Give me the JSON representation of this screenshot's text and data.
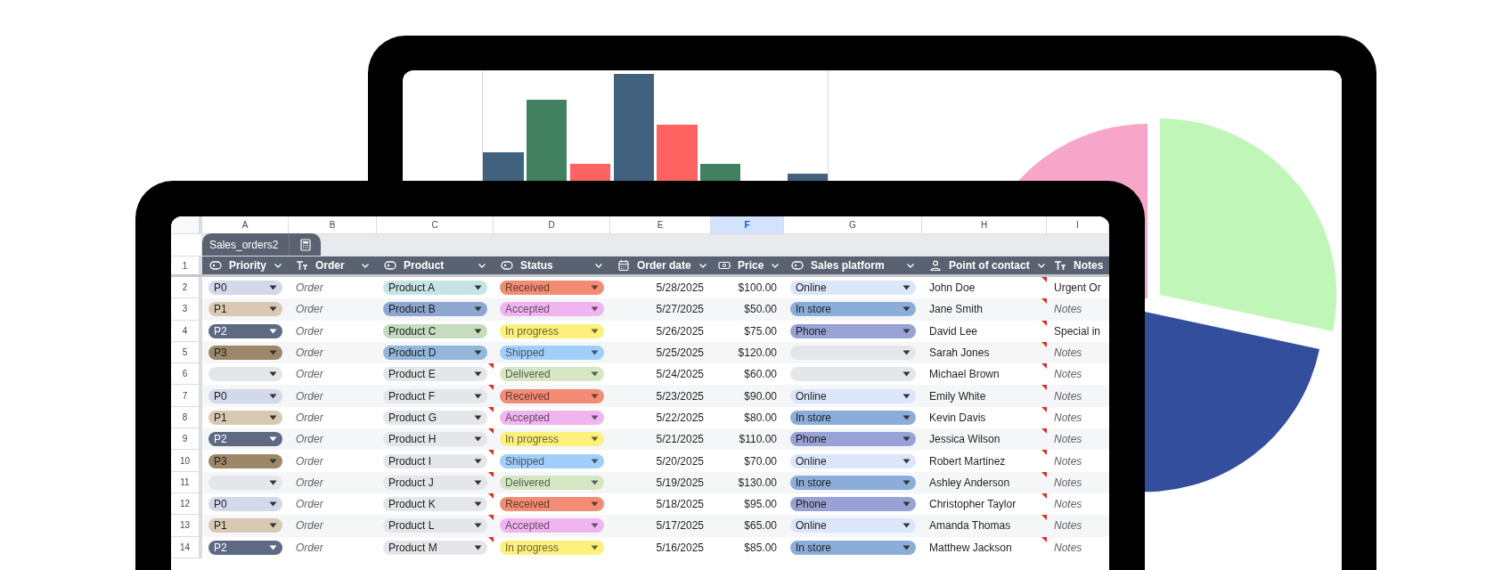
{
  "column_letters": [
    {
      "label": "A",
      "selected": false
    },
    {
      "label": "B",
      "selected": false
    },
    {
      "label": "C",
      "selected": false
    },
    {
      "label": "D",
      "selected": false
    },
    {
      "label": "E",
      "selected": false
    },
    {
      "label": "F",
      "selected": true
    },
    {
      "label": "G",
      "selected": false
    },
    {
      "label": "H",
      "selected": false
    },
    {
      "label": "I",
      "selected": false
    }
  ],
  "sheet_tabs": [
    {
      "label": "Sales_orders2",
      "selected": true
    }
  ],
  "header_row_number": "1",
  "columns": [
    {
      "label": "Priority",
      "kind": "dropdown"
    },
    {
      "label": "Order",
      "kind": "text"
    },
    {
      "label": "Product",
      "kind": "dropdown"
    },
    {
      "label": "Status",
      "kind": "dropdown"
    },
    {
      "label": "Order date",
      "kind": "date"
    },
    {
      "label": "Price",
      "kind": "currency"
    },
    {
      "label": "Sales platform",
      "kind": "dropdown"
    },
    {
      "label": "Point of contact",
      "kind": "person"
    },
    {
      "label": "Notes",
      "kind": "text"
    }
  ],
  "rows": [
    {
      "number": "2",
      "priority": {
        "text": "P0",
        "color": "#d3d8ea"
      },
      "order": "Order",
      "product": {
        "text": "Product A",
        "color": "#c6e4e3",
        "comment": false
      },
      "status": {
        "text": "Received",
        "color": "#f28c74"
      },
      "date": "5/28/2025",
      "price": "$100.00",
      "platform": {
        "text": "Online",
        "color": "#dbe6fb"
      },
      "contact": {
        "text": "John Doe",
        "comment": true
      },
      "notes": {
        "text": "Urgent Or",
        "placeholder": false
      }
    },
    {
      "number": "3",
      "priority": {
        "text": "P1",
        "color": "#d9c9b3"
      },
      "order": "Order",
      "product": {
        "text": "Product B",
        "color": "#8ea7d0",
        "comment": false
      },
      "status": {
        "text": "Accepted",
        "color": "#f0b5f0"
      },
      "date": "5/27/2025",
      "price": "$50.00",
      "platform": {
        "text": "In store",
        "color": "#8badd9"
      },
      "contact": {
        "text": "Jane Smith",
        "comment": true
      },
      "notes": {
        "text": "Notes",
        "placeholder": true
      }
    },
    {
      "number": "4",
      "priority": {
        "text": "P2",
        "color": "#5e6a82"
      },
      "order": "Order",
      "product": {
        "text": "Product C",
        "color": "#c5dcbf",
        "comment": false
      },
      "status": {
        "text": "In progress",
        "color": "#fdf07c"
      },
      "date": "5/26/2025",
      "price": "$75.00",
      "platform": {
        "text": "Phone",
        "color": "#98a2d6"
      },
      "contact": {
        "text": "David Lee",
        "comment": true
      },
      "notes": {
        "text": "Special in",
        "placeholder": false
      }
    },
    {
      "number": "5",
      "priority": {
        "text": "P3",
        "color": "#9c8768"
      },
      "order": "Order",
      "product": {
        "text": "Product D",
        "color": "#93b7da",
        "comment": false
      },
      "status": {
        "text": "Shipped",
        "color": "#a0cffa"
      },
      "date": "5/25/2025",
      "price": "$120.00",
      "platform": {
        "color": "#e5e6e9"
      },
      "contact": {
        "text": "Sarah Jones",
        "comment": true
      },
      "notes": {
        "text": "Notes",
        "placeholder": true
      }
    },
    {
      "number": "6",
      "priority": {
        "color": "#e5e6e9"
      },
      "order": "Order",
      "product": {
        "text": "Product E",
        "color": "#e5e6e9",
        "comment": true
      },
      "status": {
        "text": "Delivered",
        "color": "#d5e6c2"
      },
      "date": "5/24/2025",
      "price": "$60.00",
      "platform": {
        "color": "#e5e6e9"
      },
      "contact": {
        "text": "Michael Brown",
        "comment": true
      },
      "notes": {
        "text": "Notes",
        "placeholder": true
      }
    },
    {
      "number": "7",
      "priority": {
        "text": "P0",
        "color": "#d3d8ea"
      },
      "order": "Order",
      "product": {
        "text": "Product F",
        "color": "#e5e6e9",
        "comment": true
      },
      "status": {
        "text": "Received",
        "color": "#f28c74"
      },
      "date": "5/23/2025",
      "price": "$90.00",
      "platform": {
        "text": "Online",
        "color": "#dbe6fb"
      },
      "contact": {
        "text": "Emily White",
        "comment": true
      },
      "notes": {
        "text": "Notes",
        "placeholder": true
      }
    },
    {
      "number": "8",
      "priority": {
        "text": "P1",
        "color": "#d9c9b3"
      },
      "order": "Order",
      "product": {
        "text": "Product G",
        "color": "#e5e6e9",
        "comment": true
      },
      "status": {
        "text": "Accepted",
        "color": "#f0b5f0"
      },
      "date": "5/22/2025",
      "price": "$80.00",
      "platform": {
        "text": "In store",
        "color": "#8badd9"
      },
      "contact": {
        "text": "Kevin Davis",
        "comment": true
      },
      "notes": {
        "text": "Notes",
        "placeholder": true
      }
    },
    {
      "number": "9",
      "priority": {
        "text": "P2",
        "color": "#5e6a82"
      },
      "order": "Order",
      "product": {
        "text": "Product H",
        "color": "#e5e6e9",
        "comment": true
      },
      "status": {
        "text": "In progress",
        "color": "#fdf07c"
      },
      "date": "5/21/2025",
      "price": "$110.00",
      "platform": {
        "text": "Phone",
        "color": "#98a2d6"
      },
      "contact": {
        "text": "Jessica Wilson",
        "comment": true
      },
      "notes": {
        "text": "Notes",
        "placeholder": true
      }
    },
    {
      "number": "10",
      "priority": {
        "text": "P3",
        "color": "#9c8768"
      },
      "order": "Order",
      "product": {
        "text": "Product I",
        "color": "#e5e6e9",
        "comment": true
      },
      "status": {
        "text": "Shipped",
        "color": "#a0cffa"
      },
      "date": "5/20/2025",
      "price": "$70.00",
      "platform": {
        "text": "Online",
        "color": "#dbe6fb"
      },
      "contact": {
        "text": "Robert Martinez",
        "comment": true
      },
      "notes": {
        "text": "Notes",
        "placeholder": true
      }
    },
    {
      "number": "11",
      "priority": {
        "color": "#e5e6e9"
      },
      "order": "Order",
      "product": {
        "text": "Product J",
        "color": "#e5e6e9",
        "comment": true
      },
      "status": {
        "text": "Delivered",
        "color": "#d5e6c2"
      },
      "date": "5/19/2025",
      "price": "$130.00",
      "platform": {
        "text": "In store",
        "color": "#8badd9"
      },
      "contact": {
        "text": "Ashley Anderson",
        "comment": true
      },
      "notes": {
        "text": "Notes",
        "placeholder": true
      }
    },
    {
      "number": "12",
      "priority": {
        "text": "P0",
        "color": "#d3d8ea"
      },
      "order": "Order",
      "product": {
        "text": "Product K",
        "color": "#e5e6e9",
        "comment": true
      },
      "status": {
        "text": "Received",
        "color": "#f28c74"
      },
      "date": "5/18/2025",
      "price": "$95.00",
      "platform": {
        "text": "Phone",
        "color": "#98a2d6"
      },
      "contact": {
        "text": "Christopher Taylor",
        "comment": true
      },
      "notes": {
        "text": "Notes",
        "placeholder": true
      }
    },
    {
      "number": "13",
      "priority": {
        "text": "P1",
        "color": "#d9c9b3"
      },
      "order": "Order",
      "product": {
        "text": "Product L",
        "color": "#e5e6e9",
        "comment": true
      },
      "status": {
        "text": "Accepted",
        "color": "#f0b5f0"
      },
      "date": "5/17/2025",
      "price": "$65.00",
      "platform": {
        "text": "Online",
        "color": "#dbe6fb"
      },
      "contact": {
        "text": "Amanda Thomas",
        "comment": true
      },
      "notes": {
        "text": "Notes",
        "placeholder": true
      }
    },
    {
      "number": "14",
      "priority": {
        "text": "P2",
        "color": "#5e6a82"
      },
      "order": "Order",
      "product": {
        "text": "Product M",
        "color": "#e5e6e9",
        "comment": true
      },
      "status": {
        "text": "In progress",
        "color": "#fdf07c"
      },
      "date": "5/16/2025",
      "price": "$85.00",
      "platform": {
        "text": "In store",
        "color": "#8badd9"
      },
      "contact": {
        "text": "Matthew Jackson",
        "comment": true
      },
      "notes": {
        "text": "Notes",
        "placeholder": true
      }
    }
  ]
}
